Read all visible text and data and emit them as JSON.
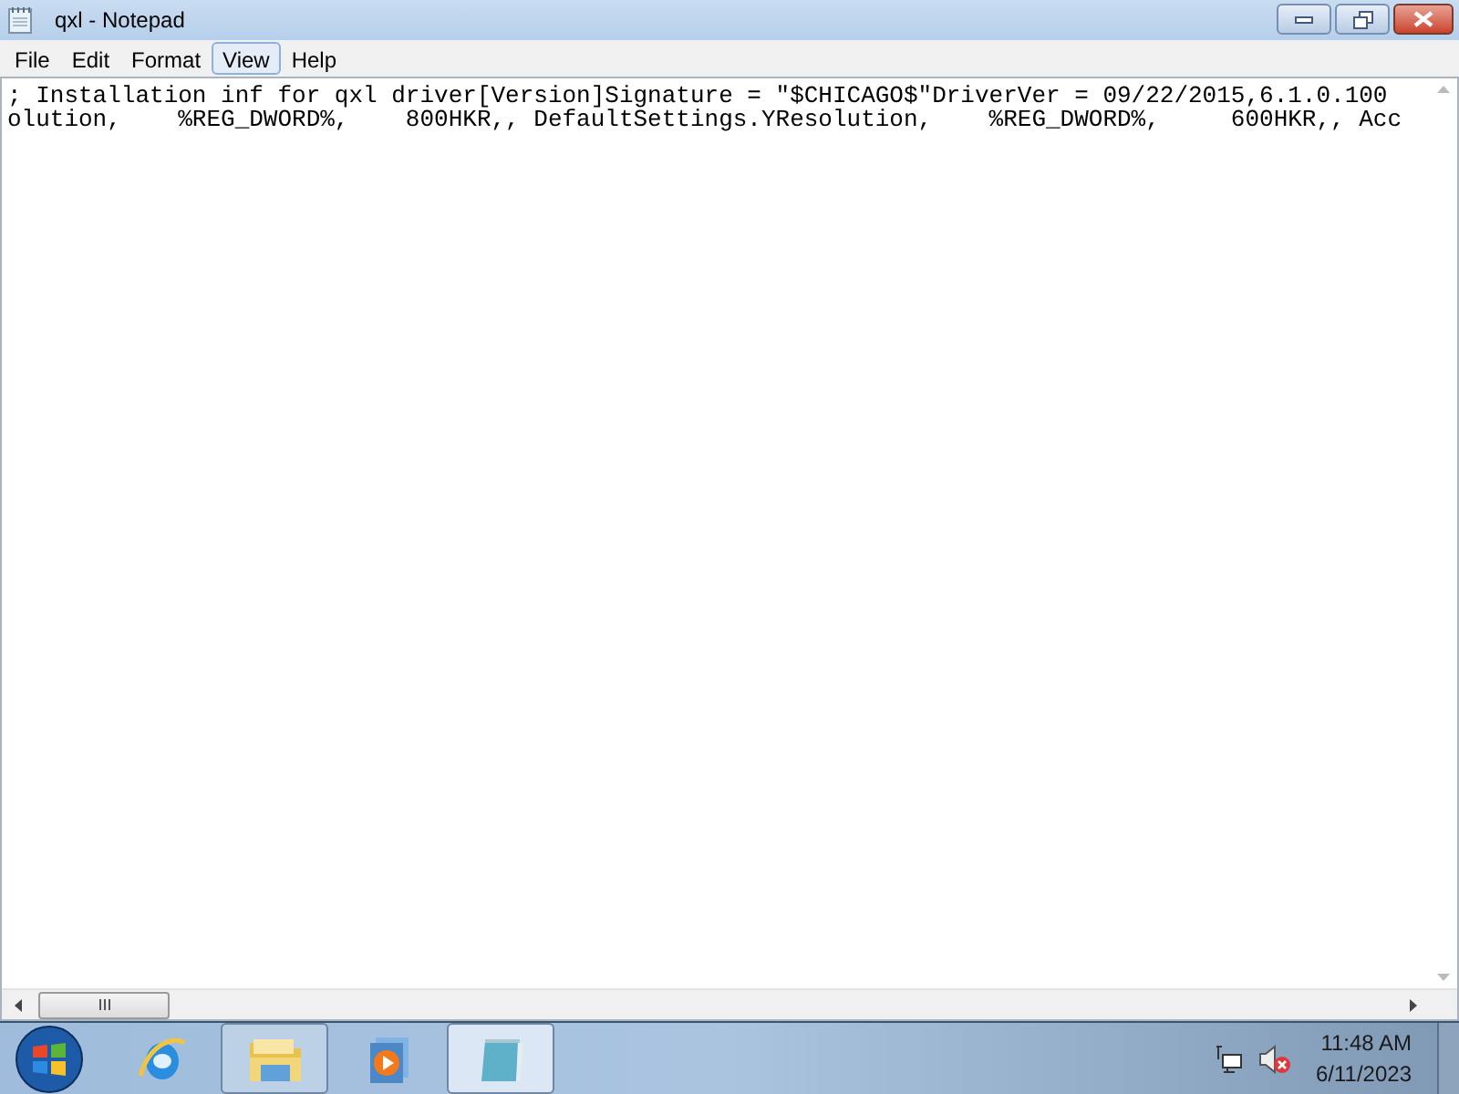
{
  "window": {
    "title": "qxl - Notepad"
  },
  "menu": [
    {
      "label": "File",
      "selected": false
    },
    {
      "label": "Edit",
      "selected": false
    },
    {
      "label": "Format",
      "selected": false
    },
    {
      "label": "View",
      "selected": true
    },
    {
      "label": "Help",
      "selected": false
    }
  ],
  "text_lines": [
    "; Installation inf for qxl driver[Version]Signature = \"$CHICAGO$\"DriverVer = 09/22/2015,6.1.0.100",
    "olution,    %REG_DWORD%,    800HKR,, DefaultSettings.YResolution,    %REG_DWORD%,     600HKR,, Acc"
  ],
  "taskbar": {
    "items": [
      {
        "running": false
      },
      {
        "running": true,
        "selected": false
      },
      {
        "running": false
      },
      {
        "running": true,
        "selected": true
      }
    ]
  },
  "tray": {
    "volume_muted": true,
    "time": "11:48 AM",
    "date": "6/11/2023"
  }
}
